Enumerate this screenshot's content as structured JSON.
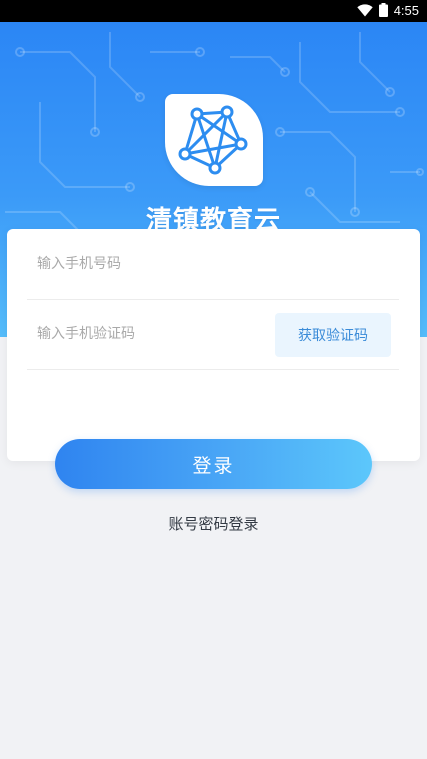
{
  "status_bar": {
    "time": "4:55",
    "icons": [
      "wifi-icon",
      "battery-icon"
    ]
  },
  "header": {
    "logo_icon": "network-nodes-icon",
    "app_title": "清镇教育云"
  },
  "form": {
    "phone_placeholder": "输入手机号码",
    "code_placeholder": "输入手机验证码",
    "get_code_label": "获取验证码"
  },
  "actions": {
    "login_label": "登录",
    "alt_login_label": "账号密码登录"
  },
  "colors": {
    "header_top": "#2b86f5",
    "header_bottom": "#55bdfb",
    "accent": "#3a8bd8",
    "page_background": "#f1f2f5"
  }
}
